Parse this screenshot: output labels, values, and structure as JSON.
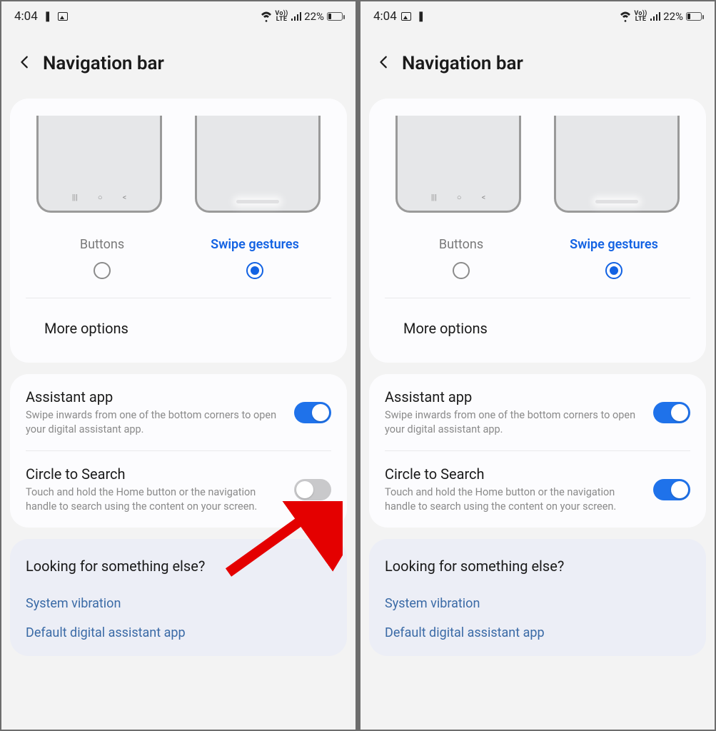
{
  "status": {
    "time": "4:04",
    "battery_pct": "22%"
  },
  "header": {
    "title": "Navigation bar"
  },
  "nav_options": {
    "buttons_label": "Buttons",
    "swipe_label": "Swipe gestures"
  },
  "more_options_label": "More options",
  "assistant": {
    "title": "Assistant app",
    "desc": "Swipe inwards from one of the bottom corners to open your digital assistant app."
  },
  "circle": {
    "title": "Circle to Search",
    "desc": "Touch and hold the Home button or the navigation handle to search using the content on your screen."
  },
  "footer": {
    "title": "Looking for something else?",
    "link1": "System vibration",
    "link2": "Default digital assistant app"
  }
}
